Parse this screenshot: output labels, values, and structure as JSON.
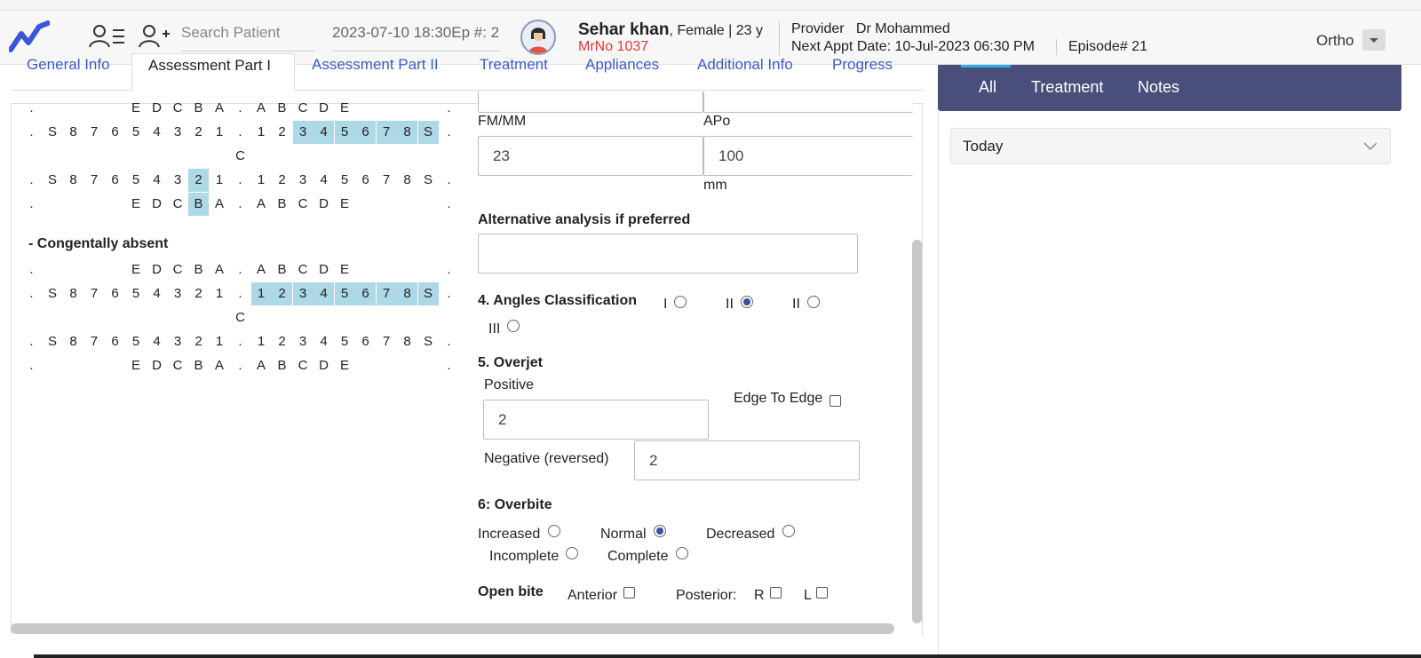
{
  "header": {
    "search_placeholder": "Search Patient",
    "appointment": "2023-07-10 18:30Ep #: 2",
    "patient_name": "Sehar khan",
    "patient_meta": ", Female | 23 y",
    "mrno": "MrNo 1037",
    "provider_label": "Provider",
    "provider_name": "Dr Mohammed",
    "next_appt": "Next Appt Date: 10-Jul-2023 06:30 PM",
    "episode": "Episode# 21",
    "specialty": "Ortho",
    "colors": {
      "brand": "#3b55d9",
      "mrno": "#e53935"
    }
  },
  "tabs": [
    "General Info",
    "Assessment Part I",
    "Assessment Part II",
    "Treatment",
    "Appliances",
    "Additional Info",
    "Progress"
  ],
  "dental": {
    "section_absent": "- Congentally absent",
    "chart1": {
      "upper_primary": ".    E D C B A . A B C D E    .",
      "rows": [
        {
          "cells": [
            ".",
            "E",
            "D",
            "C",
            "B",
            "A",
            ".",
            "A",
            "B",
            "C",
            "D",
            "E",
            "."
          ],
          "hl": []
        },
        {
          "cells": [
            ".",
            "S",
            "8",
            "7",
            "6",
            "5",
            "4",
            "3",
            "2",
            "1",
            ".",
            "1",
            "2",
            "3",
            "4",
            "5",
            "6",
            "7",
            "8",
            "S",
            "."
          ],
          "hl": [
            13,
            14,
            15,
            16,
            17,
            18,
            19
          ]
        },
        {
          "cells": [
            "C"
          ],
          "hl": []
        },
        {
          "cells": [
            ".",
            "S",
            "8",
            "7",
            "6",
            "5",
            "4",
            "3",
            "2",
            "1",
            ".",
            "1",
            "2",
            "3",
            "4",
            "5",
            "6",
            "7",
            "8",
            "S",
            "."
          ],
          "hl": [
            8
          ]
        },
        {
          "cells": [
            ".",
            "E",
            "D",
            "C",
            "B",
            "A",
            ".",
            "A",
            "B",
            "C",
            "D",
            "E",
            "."
          ],
          "hl": [
            4
          ]
        }
      ]
    },
    "chart2": {
      "rows": [
        {
          "cells": [
            ".",
            "E",
            "D",
            "C",
            "B",
            "A",
            ".",
            "A",
            "B",
            "C",
            "D",
            "E",
            "."
          ],
          "hl": []
        },
        {
          "cells": [
            ".",
            "S",
            "8",
            "7",
            "6",
            "5",
            "4",
            "3",
            "2",
            "1",
            ".",
            "1",
            "2",
            "3",
            "4",
            "5",
            "6",
            "7",
            "8",
            "S",
            "."
          ],
          "hl": [
            11,
            12,
            13,
            14,
            15,
            16,
            17,
            18,
            19
          ]
        },
        {
          "cells": [
            "C"
          ],
          "hl": []
        },
        {
          "cells": [
            ".",
            "S",
            "8",
            "7",
            "6",
            "5",
            "4",
            "3",
            "2",
            "1",
            ".",
            "1",
            "2",
            "3",
            "4",
            "5",
            "6",
            "7",
            "8",
            "S",
            "."
          ],
          "hl": []
        },
        {
          "cells": [
            ".",
            "E",
            "D",
            "C",
            "B",
            "A",
            ".",
            "A",
            "B",
            "C",
            "D",
            "E",
            "."
          ],
          "hl": []
        }
      ]
    }
  },
  "form": {
    "fm_mm_label": "FM/MM",
    "fm_mm_value": "23",
    "apo_label": "APo",
    "apo_value": "100",
    "apo_unit": "mm",
    "alt_label": "Alternative analysis if preferred",
    "alt_value": "",
    "angles_label": "4. Angles Classification",
    "angles_options": [
      "I",
      "II",
      "II",
      "III"
    ],
    "angles_selected": 1,
    "overjet_label": "5. Overjet",
    "positive_label": "Positive",
    "positive_value": "2",
    "edge_label": "Edge To Edge",
    "negative_label": "Negative (reversed)",
    "negative_value": "2",
    "overbite_label": "6: Overbite",
    "overbite_options": [
      "Increased",
      "Normal",
      "Decreased",
      "Incomplete",
      "Complete"
    ],
    "overbite_selected": 1,
    "openbite_label": "Open bite",
    "anterior_label": "Anterior",
    "posterior_label": "Posterior:",
    "r_label": "R",
    "l_label": "L"
  },
  "right_panel": {
    "tabs": [
      "All",
      "Treatment",
      "Notes"
    ],
    "active_tab": "All",
    "today_label": "Today",
    "colors": {
      "bar": "#4a4e7a",
      "accent": "#2bb3e8"
    }
  }
}
